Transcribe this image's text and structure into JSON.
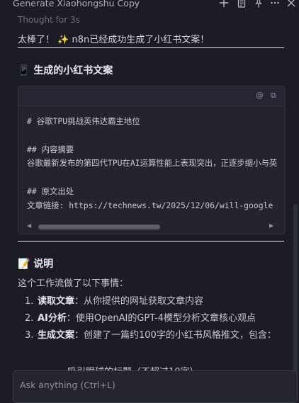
{
  "header": {
    "title": "Generate Xiaohongshu Copy",
    "icons": [
      "chevron-down-icon",
      "plus-icon",
      "clipboard-icon",
      "pin-icon",
      "more-icon",
      "close-icon"
    ]
  },
  "thought": "Thought for 3s",
  "lead": "太棒了！ ✨ n8n已经成功生成了小红书文案！",
  "section1": {
    "emoji": "📱",
    "title": "生成的小红书文案"
  },
  "code": {
    "actions": [
      "@",
      "⧉"
    ],
    "lines": [
      "# 谷歌TPU挑战英伟达霸主地位",
      "",
      "## 内容摘要",
      "谷歌最新发布的第四代TPU在AI运算性能上表现突出，正逐步缩小与英",
      "",
      "## 原文出处",
      "文章链接: https://technews.tw/2025/12/06/will-google"
    ]
  },
  "section2": {
    "emoji": "📝",
    "title": "说明"
  },
  "para": "这个工作流做了以下事情：",
  "steps": [
    {
      "num": "1.",
      "bold": "读取文章",
      "text": "：从你提供的网址获取文章内容"
    },
    {
      "num": "2.",
      "bold": "AI分析",
      "text": "：使用OpenAI的GPT-4模型分析文章核心观点"
    },
    {
      "num": "3.",
      "bold": "生成文案",
      "text": "：创建了一篇约100字的小红书风格推文，包含："
    }
  ],
  "subitem": "吸引眼球的标题（不超过10字）",
  "composer": {
    "placeholder": "Ask anything (Ctrl+L)"
  }
}
